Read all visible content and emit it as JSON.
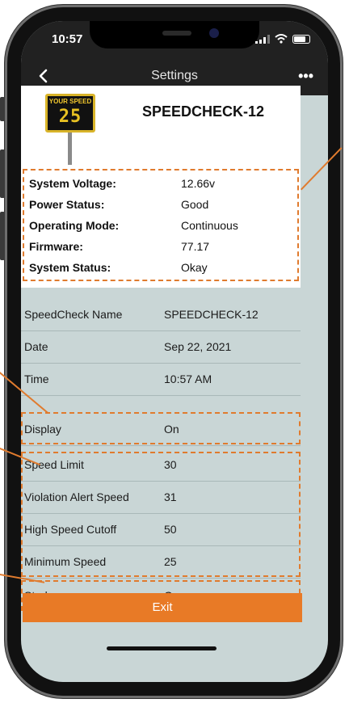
{
  "status": {
    "time": "10:57"
  },
  "nav": {
    "title": "Settings"
  },
  "device": {
    "sign_label": "YOUR SPEED",
    "sign_value": "25",
    "name": "SPEEDCHECK-12"
  },
  "info": [
    {
      "label": "System Voltage:",
      "value": "12.66v"
    },
    {
      "label": "Power Status:",
      "value": "Good"
    },
    {
      "label": "Operating Mode:",
      "value": "Continuous"
    },
    {
      "label": "Firmware:",
      "value": "77.17"
    },
    {
      "label": "System Status:",
      "value": "Okay"
    }
  ],
  "settings": [
    {
      "label": "SpeedCheck Name",
      "value": "SPEEDCHECK-12"
    },
    {
      "label": "Date",
      "value": "Sep 22, 2021"
    },
    {
      "label": "Time",
      "value": "10:57 AM"
    },
    {
      "label": "Display",
      "value": "On"
    },
    {
      "label": "Speed Limit",
      "value": "30"
    },
    {
      "label": "Violation Alert Speed",
      "value": "31"
    },
    {
      "label": "High Speed Cutoff",
      "value": "50"
    },
    {
      "label": "Minimum Speed",
      "value": "25"
    },
    {
      "label": "Strobe",
      "value": "On"
    }
  ],
  "exit_label": "Exit",
  "colors": {
    "accent": "#e87a26",
    "highlight": "#e07b2e",
    "background": "#c9d6d6",
    "navbar": "#212121"
  }
}
